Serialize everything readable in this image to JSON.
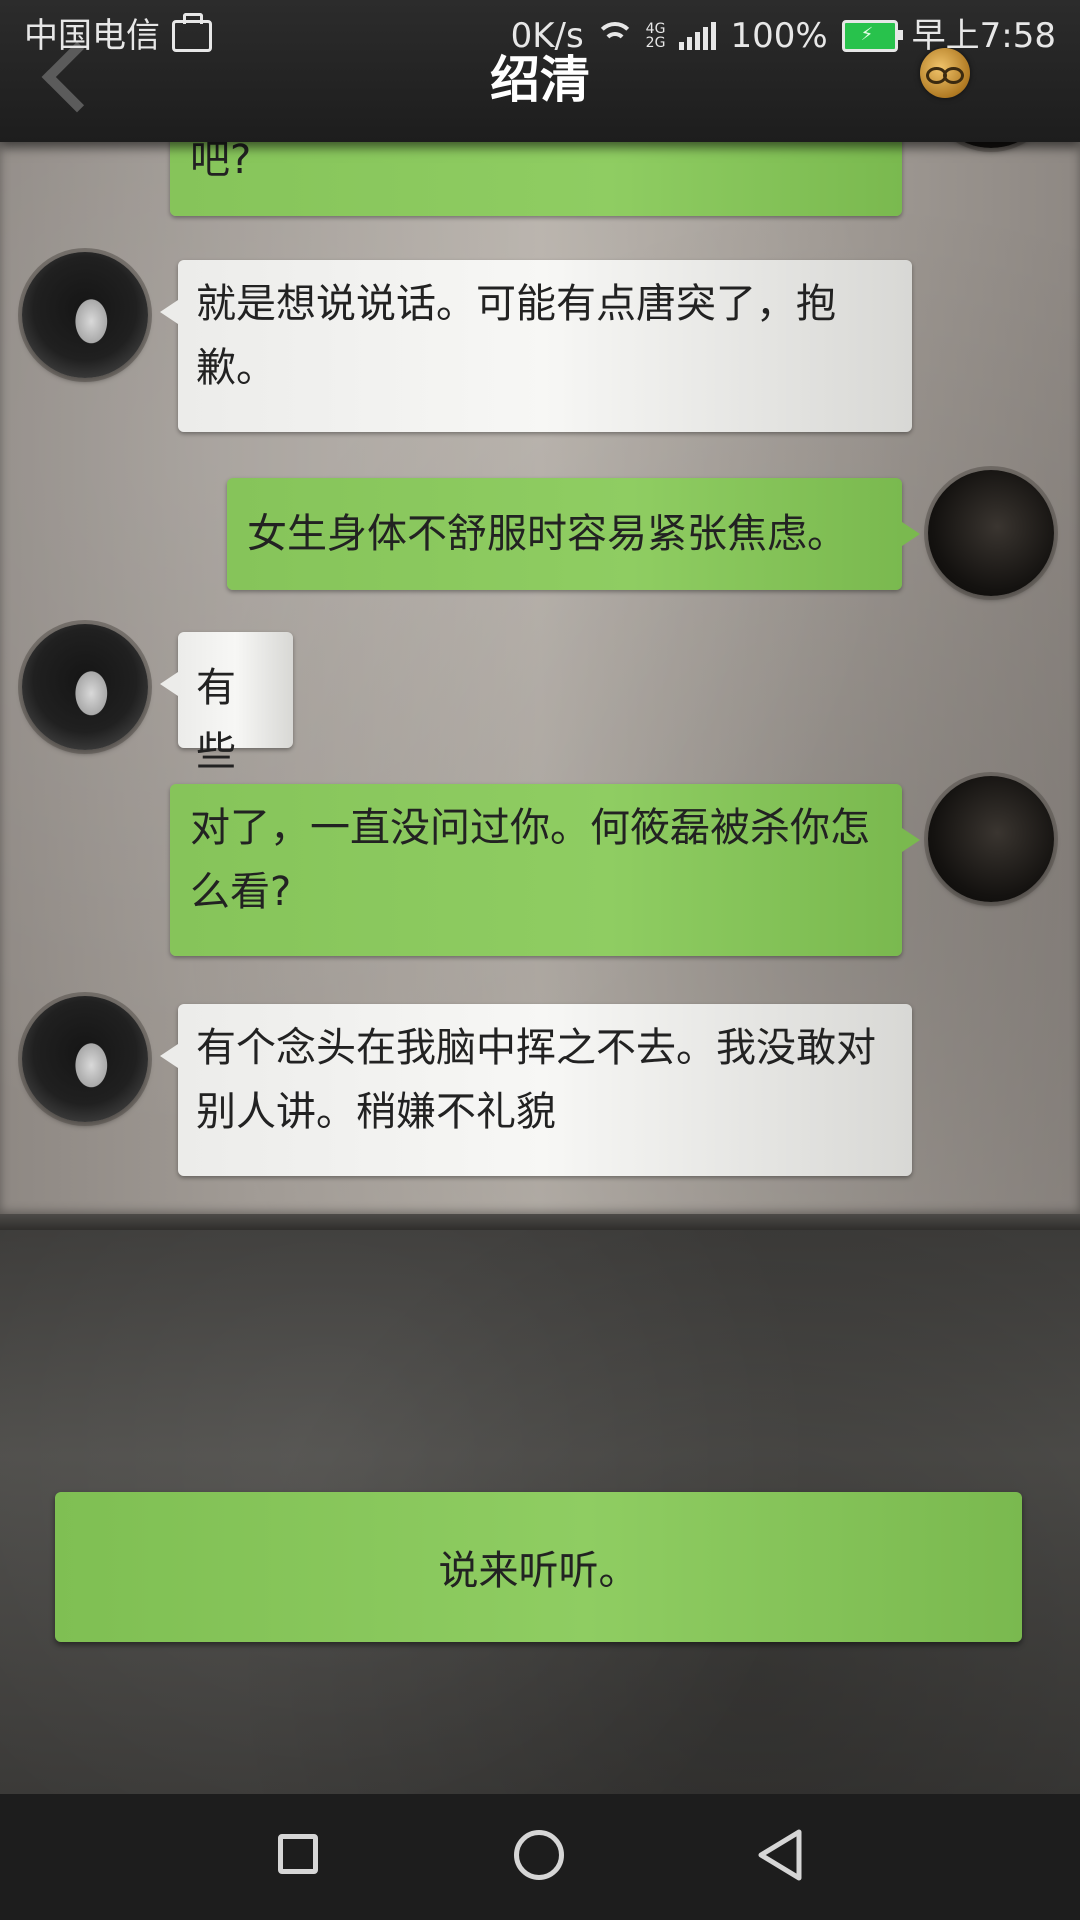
{
  "status_bar": {
    "carrier": "中国电信",
    "speed": "0K/s",
    "network_top": "4G",
    "network_bottom": "2G",
    "battery": "100%",
    "time": "早上7:58"
  },
  "header": {
    "title": "绍清"
  },
  "messages": [
    {
      "side": "right",
      "color": "green",
      "text": "吧?"
    },
    {
      "side": "left",
      "color": "white",
      "text": "就是想说说话。可能有点唐突了，抱歉。"
    },
    {
      "side": "right",
      "color": "green",
      "text": "女生身体不舒服时容易紧张焦虑。"
    },
    {
      "side": "left",
      "color": "white",
      "text": "有些"
    },
    {
      "side": "right",
      "color": "green",
      "text": "对了，一直没问过你。何筱磊被杀你怎么看?"
    },
    {
      "side": "left",
      "color": "white",
      "text": "有个念头在我脑中挥之不去。我没敢对别人讲。稍嫌不礼貌"
    }
  ],
  "reply_option": {
    "text": "说来听听。"
  },
  "icons": {
    "back": "chevron-left-icon",
    "badge": "glasses-badge-icon",
    "nav_recents": "square-icon",
    "nav_home": "circle-icon",
    "nav_back": "triangle-back-icon"
  },
  "colors": {
    "green_bubble": "#8fcd62",
    "white_bubble": "#f2f2f0",
    "header_bg": "#1f1f1f"
  }
}
